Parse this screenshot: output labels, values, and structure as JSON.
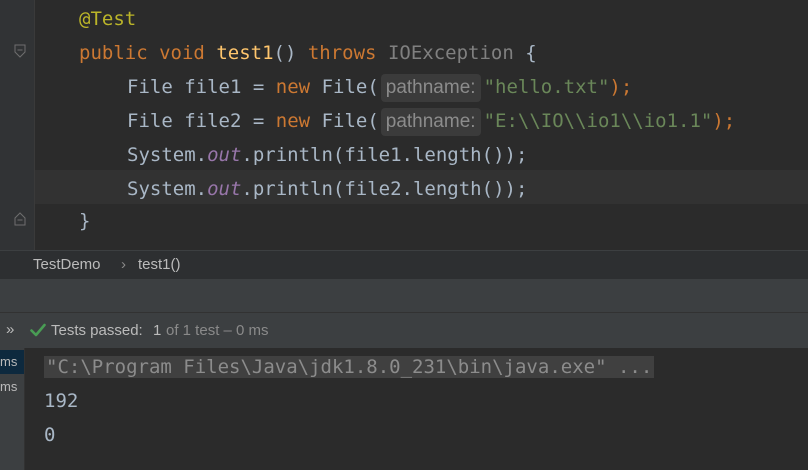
{
  "editor": {
    "lines": {
      "annotation": "@Test",
      "method": {
        "public": "public",
        "void": "void",
        "name": "test1",
        "parens": "()",
        "throws": "throws",
        "exception": "IOException",
        "brace": "{"
      },
      "file1": {
        "type": "File",
        "var": "file1",
        "eq": "=",
        "new": "new",
        "ctor": "File(",
        "hint": "pathname:",
        "arg": "\"hello.txt\"",
        "end": ");"
      },
      "file2": {
        "type": "File",
        "var": "file2",
        "eq": "=",
        "new": "new",
        "ctor": "File(",
        "hint": "pathname:",
        "arg": "\"E:\\\\IO\\\\io1\\\\io1.1\"",
        "end": ");"
      },
      "print1": {
        "system": "System.",
        "out": "out",
        "call": ".println(file1.length());"
      },
      "print2": {
        "system": "System.",
        "out": "out",
        "call": ".println(file2.length());"
      },
      "close_brace": "}"
    }
  },
  "breadcrumb": {
    "class_name": "TestDemo",
    "separator": "›",
    "method_name": "test1()"
  },
  "tests": {
    "expand_icon": "double-chevron-right-icon",
    "status_icon": "check-icon",
    "passed_label": "Tests passed:",
    "passed_count": "1",
    "detail": "of 1 test – 0 ms"
  },
  "console": {
    "side_items": [
      "ms",
      "ms"
    ],
    "output": [
      "\"C:\\Program Files\\Java\\jdk1.8.0_231\\bin\\java.exe\" ...",
      "192",
      "0"
    ]
  },
  "colors": {
    "background": "#2b2b2b",
    "keyword": "#cc7832",
    "string": "#6a8759",
    "annotation": "#bbb529",
    "method": "#ffc66d",
    "field": "#9876aa",
    "success": "#499c54"
  }
}
